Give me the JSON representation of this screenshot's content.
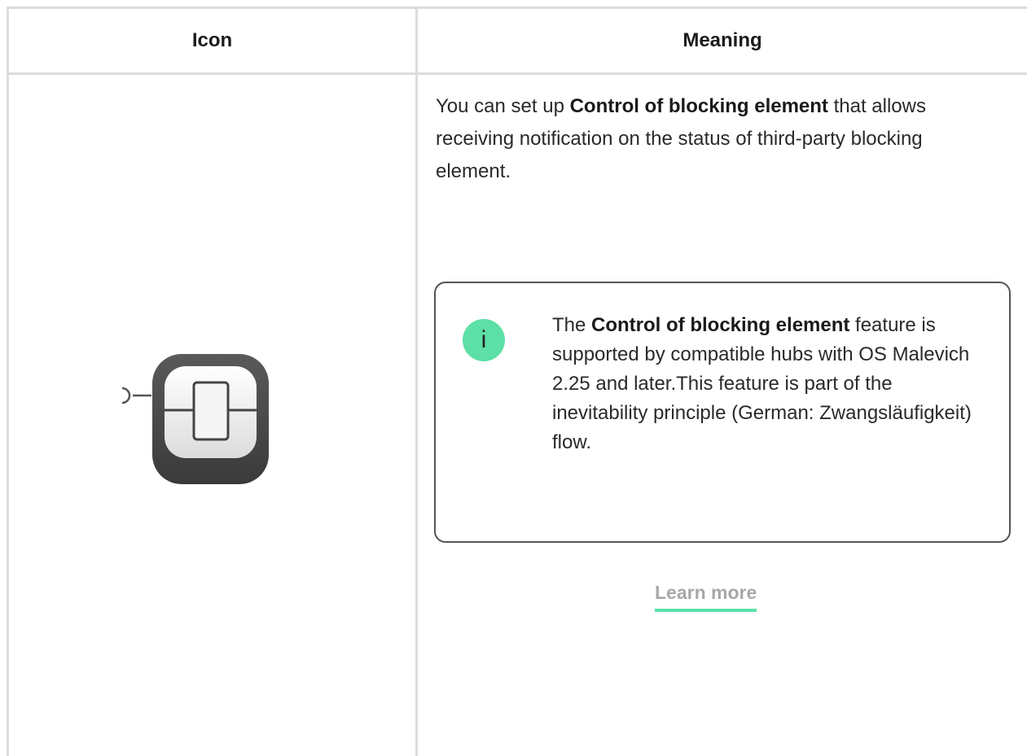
{
  "table": {
    "headers": {
      "icon": "Icon",
      "meaning": "Meaning"
    },
    "rows": [
      {
        "icon_name": "control-of-blocking-element-icon",
        "description": {
          "prefix": "You can set up ",
          "bold": "Control of blocking element",
          "suffix": " that allows receiving notification on the status of third-party blocking element."
        },
        "note": {
          "badge": "i",
          "prefix": "The ",
          "bold": "Control of blocking element",
          "suffix": " feature is supported by compatible hubs with OS Malevich 2.25 and later.This feature is part of the inevitability principle (German: Zwangsläufigkeit) flow.",
          "link_label": "Learn more"
        }
      }
    ]
  },
  "colors": {
    "accent": "#5ddfa8",
    "border": "#dcdcdc",
    "note_border": "#555555",
    "link_text": "#a8a8a8"
  }
}
